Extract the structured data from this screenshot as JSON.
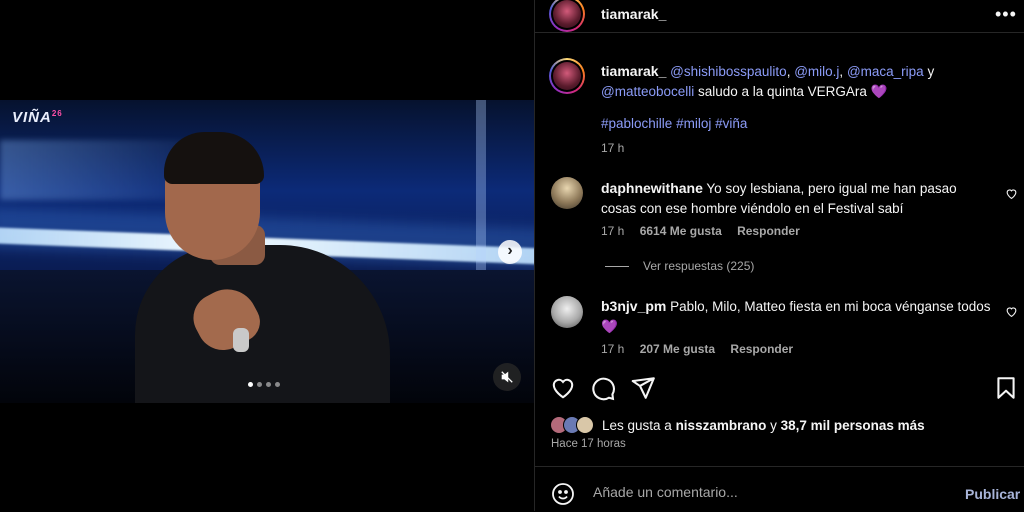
{
  "media": {
    "logo_text": "VIÑA",
    "logo_sup": "26",
    "carousel_count": 4,
    "carousel_active": 0
  },
  "post": {
    "author": "tiamarak_",
    "caption_mentions": [
      "@shishibosspaulito",
      "@milo.j",
      "@maca_ripa"
    ],
    "caption_y": " y",
    "caption_mention_last": "@matteobocelli",
    "caption_text": " saludo a la quinta VERGAra 💜",
    "hashtags": [
      "#pablochille",
      "#miloj",
      "#viña"
    ],
    "time": "17 h"
  },
  "comments": [
    {
      "user": "daphnewithane",
      "text": "Yo soy lesbiana, pero igual me han pasao cosas con ese hombre viéndolo en el Festival sabí",
      "time": "17 h",
      "likes": "6614 Me gusta",
      "reply_label": "Responder",
      "replies_label": "Ver respuestas (225)"
    },
    {
      "user": "b3njv_pm",
      "text": "Pablo, Milo, Matteo fiesta en mi boca vénganse todos 💜",
      "time": "17 h",
      "likes": "207 Me gusta",
      "reply_label": "Responder"
    }
  ],
  "likes": {
    "prefix": "Les gusta a ",
    "user": "nisszambrano",
    "middle": " y ",
    "count": "38,7 mil personas más"
  },
  "posted_ago": "Hace 17 horas",
  "comment_box": {
    "placeholder": "Añade un comentario...",
    "publish_label": "Publicar"
  },
  "icons": [
    "like-icon",
    "comment-icon",
    "share-icon",
    "save-icon",
    "emoji-icon",
    "mute-icon",
    "chevron-right-icon",
    "more-icon"
  ]
}
